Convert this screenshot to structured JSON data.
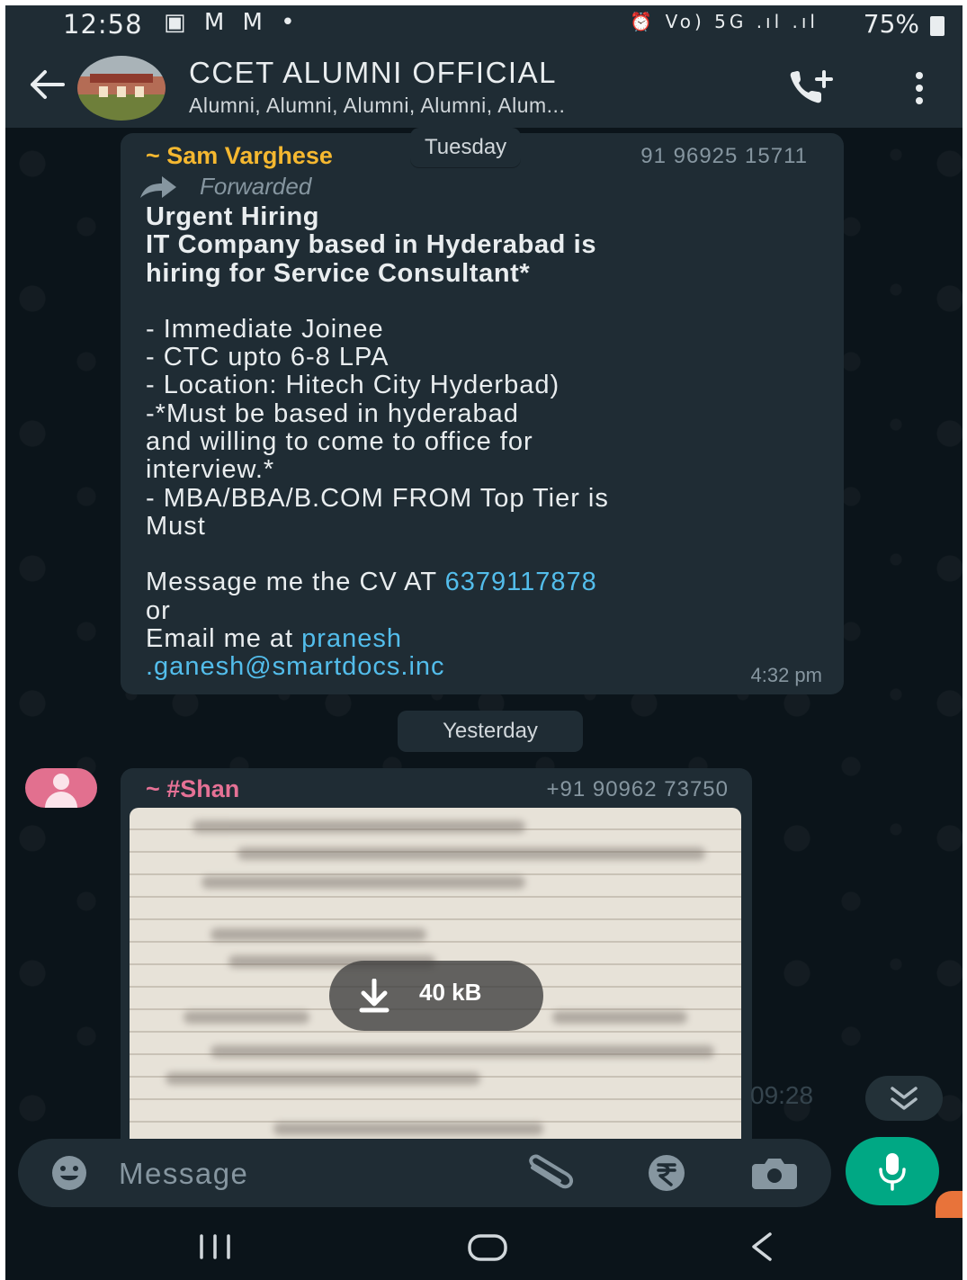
{
  "status_bar": {
    "time": "12:58",
    "left_icons": "▣ M M •",
    "sys_icons": "⏰ Vo) 5G .ıl .ıl",
    "battery": "75%"
  },
  "header": {
    "title": "CCET ALUMNI OFFICIAL",
    "subtitle": "Alumni, Alumni, Alumni, Alumni, Alum..."
  },
  "messages": [
    {
      "sender": "~ Sam Varghese",
      "phone": "91 96925 15711",
      "day_label": "Tuesday",
      "forwarded_label": "Forwarded",
      "lines": {
        "l1": "Urgent Hiring",
        "l2": "IT Company based in Hyderabad is",
        "l3": "hiring for Service Consultant*",
        "l4": "- Immediate Joinee",
        "l5": "- CTC upto 6-8 LPA",
        "l6": "- Location: Hitech City Hyderbad)",
        "l7": "-*Must be based in hyderabad",
        "l8": "and willing to come to office for",
        "l9": "interview.*",
        "l10": "- MBA/BBA/B.COM FROM Top Tier is",
        "l11": "Must",
        "l12_prefix": "Message me the CV AT ",
        "l12_link": "6379117878",
        "l13": "or",
        "l14_prefix": "Email me at ",
        "l14_link": "pranesh",
        "l15_link": ".ganesh@smartdocs.inc"
      },
      "time": "4:32 pm"
    },
    {
      "date_divider": "Yesterday",
      "sender": "~ #Shan",
      "phone": "+91 90962 73750",
      "attachment_size": "40 kB",
      "ghost_time": "09:28"
    }
  ],
  "input": {
    "placeholder": "Message"
  },
  "icons": {
    "back": "back-arrow-icon",
    "call": "add-call-icon",
    "menu": "more-vertical-icon",
    "emoji": "emoji-icon",
    "attach": "paperclip-icon",
    "payment": "rupee-icon",
    "camera": "camera-icon",
    "mic": "mic-icon",
    "download": "download-icon",
    "scroll": "chevron-double-down-icon"
  },
  "colors": {
    "background": "#0b141a",
    "bar": "#1f2c34",
    "sender1": "#f5b830",
    "sender2": "#e57195",
    "link": "#53bdeb",
    "accent": "#00a884"
  }
}
